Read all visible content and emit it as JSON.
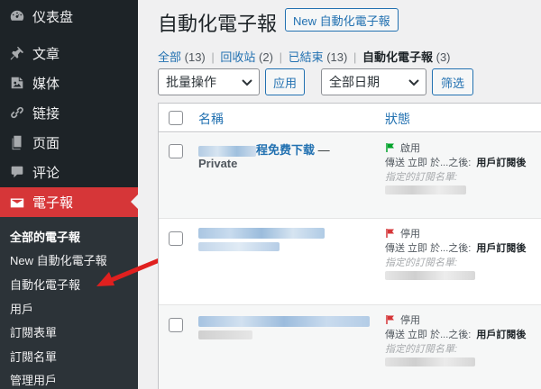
{
  "sidebar": {
    "items": [
      {
        "label": "仪表盘",
        "icon": "dashboard-icon"
      },
      {
        "label": "文章",
        "icon": "pin-icon"
      },
      {
        "label": "媒体",
        "icon": "media-icon"
      },
      {
        "label": "链接",
        "icon": "link-icon"
      },
      {
        "label": "页面",
        "icon": "page-icon"
      },
      {
        "label": "评论",
        "icon": "comment-icon"
      },
      {
        "label": "電子報",
        "icon": "mail-icon"
      }
    ],
    "submenu": [
      "全部的電子報",
      "New 自動化電子報",
      "自動化電子報",
      "用戶",
      "訂閱表單",
      "訂閱名單",
      "管理用戶"
    ]
  },
  "header": {
    "title": "自動化電子報",
    "new_button": "New 自動化電子報"
  },
  "views": {
    "all_label": "全部",
    "all_count": "(13)",
    "trash_label": "回收站",
    "trash_count": "(2)",
    "ended_label": "已結束",
    "ended_count": "(13)",
    "current_label": "自動化電子報",
    "current_count": "(3)"
  },
  "filters": {
    "bulk_action": "批量操作",
    "apply": "应用",
    "date": "全部日期",
    "filter": "筛选"
  },
  "table": {
    "col_title": "名稱",
    "col_status": "狀態",
    "rows": [
      {
        "title_visible": "程免费下载",
        "dash": "—",
        "state": "Private",
        "status": "啟用",
        "send_label": "傳送 立即 於...之後:",
        "send_trigger": "用戶訂閱後",
        "list_label": "指定的訂閱名單:",
        "flag_color": "#00a32a"
      },
      {
        "status": "停用",
        "send_label": "傳送 立即 於...之後:",
        "send_trigger": "用戶訂閱後",
        "list_label": "指定的訂閱名單:",
        "flag_color": "#d63638"
      },
      {
        "status": "停用",
        "send_label": "傳送 立即 於...之後:",
        "send_trigger": "用戶訂閱後",
        "list_label": "指定的訂閱名單:",
        "flag_color": "#d63638"
      }
    ]
  },
  "colors": {
    "sidebar_bg": "#1d2327",
    "active_menu": "#d63638",
    "link": "#2271b1",
    "annotation_arrow": "#e0201f"
  }
}
